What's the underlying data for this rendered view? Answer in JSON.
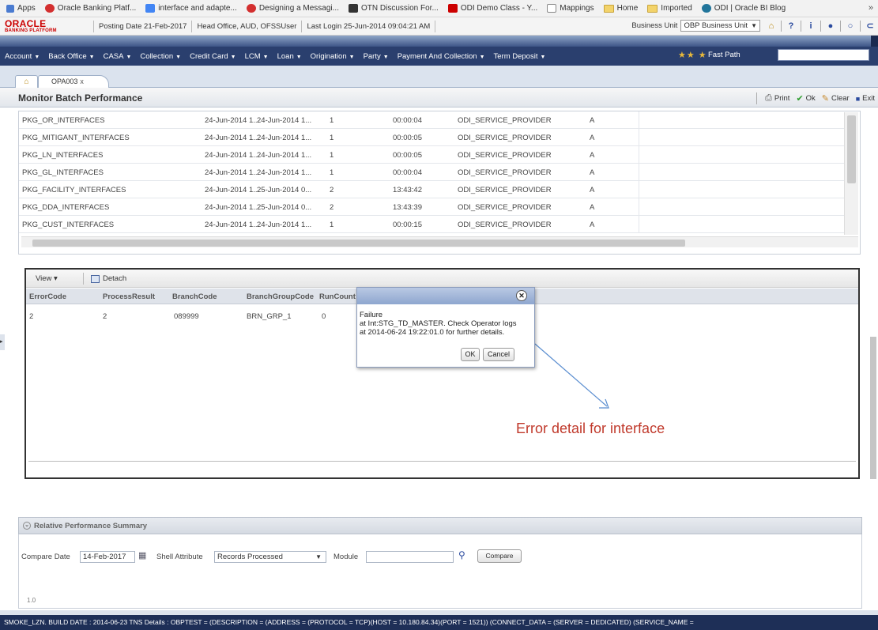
{
  "browser": {
    "bookmarks": [
      {
        "label": "Apps",
        "icon": "apps-grid-icon",
        "color": "#4a7bd0"
      },
      {
        "label": "Oracle Banking Platf...",
        "icon": "oracle-icon",
        "color": "#d32f2f"
      },
      {
        "label": "interface and adapte...",
        "icon": "google-icon",
        "color": "#4285f4"
      },
      {
        "label": "Designing a Messagi...",
        "icon": "oracle-icon",
        "color": "#d32f2f"
      },
      {
        "label": "OTN Discussion For...",
        "icon": "otn-icon",
        "color": "#333333"
      },
      {
        "label": "ODI Demo Class - Y...",
        "icon": "youtube-icon",
        "color": "#cc0000"
      },
      {
        "label": "Mappings",
        "icon": "page-icon",
        "color": "#888888"
      },
      {
        "label": "Home",
        "icon": "folder-icon",
        "color": "#f3d36a"
      },
      {
        "label": "Imported",
        "icon": "folder-icon",
        "color": "#f3d36a"
      },
      {
        "label": "ODI | Oracle BI Blog",
        "icon": "wordpress-icon",
        "color": "#21759b"
      }
    ],
    "more": "»"
  },
  "header": {
    "logo_line1": "ORACLE",
    "logo_line2": "BANKING PLATFORM",
    "posting_date": "Posting Date 21-Feb-2017",
    "branch_info": "Head Office, AUD, OFSSUser",
    "last_login": "Last Login 25-Jun-2014 09:04:21 AM",
    "business_unit_label": "Business Unit",
    "business_unit_value": "OBP Business Unit",
    "icons": [
      "home-icon",
      "help-icon",
      "info-icon",
      "user-icon",
      "power-icon",
      "logout-icon"
    ]
  },
  "menu": {
    "items": [
      "Account",
      "Back Office",
      "CASA",
      "Collection",
      "Credit Card",
      "LCM",
      "Loan",
      "Origination",
      "Party",
      "Payment And Collection",
      "Term Deposit"
    ],
    "arrow": "▼",
    "fast_path_label": "Fast Path",
    "fast_path_value": ""
  },
  "tabs": {
    "home_icon": "home-icon",
    "active_tab": "OPA003",
    "close": "x"
  },
  "page": {
    "title": "Monitor Batch Performance",
    "actions": [
      {
        "label": "Print",
        "icon": "print-icon",
        "glyph": "⎙",
        "color": "#555555"
      },
      {
        "label": "Ok",
        "icon": "check-icon",
        "glyph": "✔",
        "color": "#2e9d2e"
      },
      {
        "label": "Clear",
        "icon": "eraser-icon",
        "glyph": "✎",
        "color": "#c7892a"
      },
      {
        "label": "Exit",
        "icon": "exit-icon",
        "glyph": "■",
        "color": "#2a4a9e"
      }
    ]
  },
  "batch_grid": {
    "rows": [
      [
        "PKG_OR_INTERFACES",
        "24-Jun-2014 1...",
        "24-Jun-2014 1...",
        "1",
        "00:00:04",
        "ODI_SERVICE_PROVIDER",
        "A"
      ],
      [
        "PKG_MITIGANT_INTERFACES",
        "24-Jun-2014 1...",
        "24-Jun-2014 1...",
        "1",
        "00:00:05",
        "ODI_SERVICE_PROVIDER",
        "A"
      ],
      [
        "PKG_LN_INTERFACES",
        "24-Jun-2014 1...",
        "24-Jun-2014 1...",
        "1",
        "00:00:05",
        "ODI_SERVICE_PROVIDER",
        "A"
      ],
      [
        "PKG_GL_INTERFACES",
        "24-Jun-2014 1...",
        "24-Jun-2014 1...",
        "1",
        "00:00:04",
        "ODI_SERVICE_PROVIDER",
        "A"
      ],
      [
        "PKG_FACILITY_INTERFACES",
        "24-Jun-2014 1...",
        "25-Jun-2014 0...",
        "2",
        "13:43:42",
        "ODI_SERVICE_PROVIDER",
        "A"
      ],
      [
        "PKG_DDA_INTERFACES",
        "24-Jun-2014 1...",
        "25-Jun-2014 0...",
        "2",
        "13:43:39",
        "ODI_SERVICE_PROVIDER",
        "A"
      ],
      [
        "PKG_CUST_INTERFACES",
        "24-Jun-2014 1...",
        "24-Jun-2014 1...",
        "1",
        "00:00:15",
        "ODI_SERVICE_PROVIDER",
        "A"
      ]
    ]
  },
  "error_panel": {
    "view_label": "View ▾",
    "detach_label": "Detach",
    "columns": [
      "ErrorCode",
      "ProcessResult",
      "BranchCode",
      "BranchGroupCode",
      "RunCount"
    ],
    "row": [
      "2",
      "2",
      "089999",
      "BRN_GRP_1",
      "0"
    ]
  },
  "dialog": {
    "line1": "Failure",
    "line2": "at Int:STG_TD_MASTER. Check Operator logs",
    "line3": "at 2014-06-24 19:22:01.0 for further details.",
    "ok_label": "OK",
    "cancel_label": "Cancel",
    "close_glyph": "✕"
  },
  "annotation": {
    "text": "Error detail for interface",
    "color": "#c0392b"
  },
  "summary": {
    "title": "Relative Performance Summary",
    "toggle": "⌄",
    "compare_date_label": "Compare Date",
    "compare_date_value": "14-Feb-2017",
    "shell_attribute_label": "Shell Attribute",
    "shell_attribute_value": "Records Processed",
    "module_label": "Module",
    "module_value": "",
    "compare_button": "Compare",
    "chart_tick": "1.0"
  },
  "statusbar": {
    "text": "SMOKE_LZN. BUILD DATE : 2014-06-23 TNS Details : OBPTEST = (DESCRIPTION = (ADDRESS = (PROTOCOL = TCP)(HOST = 10.180.84.34)(PORT = 1521)) (CONNECT_DATA = (SERVER = DEDICATED) (SERVICE_NAME ="
  }
}
